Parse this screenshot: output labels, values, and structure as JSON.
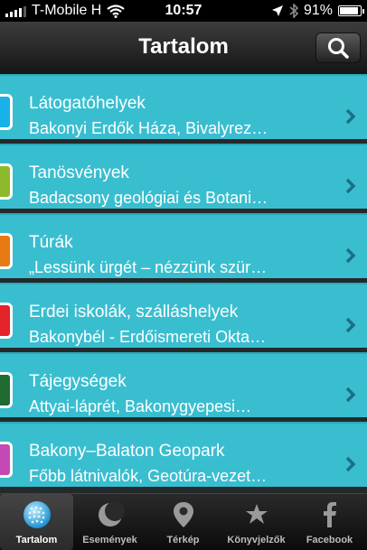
{
  "status": {
    "carrier": "T-Mobile H",
    "time": "10:57",
    "battery": "91%",
    "battery_level": 0.91
  },
  "nav": {
    "title": "Tartalom",
    "search_icon": "search-icon"
  },
  "colors": {
    "row_bg": "#39bed0",
    "nav_bg": "#2b2b2b"
  },
  "list": {
    "items": [
      {
        "title": "Látogatóhelyek",
        "subtitle": "Bakonyi Erdők Háza, Bivalyrez…",
        "color": "#1ab0e8"
      },
      {
        "title": "Tanösvények",
        "subtitle": "Badacsony geológiai és Botani…",
        "color": "#8db92a"
      },
      {
        "title": "Túrák",
        "subtitle": "„Lessünk ürgét – nézzünk szür…",
        "color": "#e87a13"
      },
      {
        "title": "Erdei iskolák, szálláshelyek",
        "subtitle": "Bakonybél - Erdőismereti Okta…",
        "color": "#e5232a"
      },
      {
        "title": "Tájegységek",
        "subtitle": "Attyai-láprét, Bakonygyepesi…",
        "color": "#1f6b31"
      },
      {
        "title": "Bakony–Balaton Geopark",
        "subtitle": "Főbb látnivalók, Geotúra-vezet…",
        "color": "#c548b7"
      }
    ]
  },
  "tabs": [
    {
      "label": "Tartalom",
      "icon": "globe-icon",
      "active": true
    },
    {
      "label": "Események",
      "icon": "moon-icon",
      "active": false
    },
    {
      "label": "Térkép",
      "icon": "map-pin-icon",
      "active": false
    },
    {
      "label": "Könyvjelzők",
      "icon": "stars-icon",
      "active": false
    },
    {
      "label": "Facebook",
      "icon": "facebook-icon",
      "active": false
    }
  ]
}
